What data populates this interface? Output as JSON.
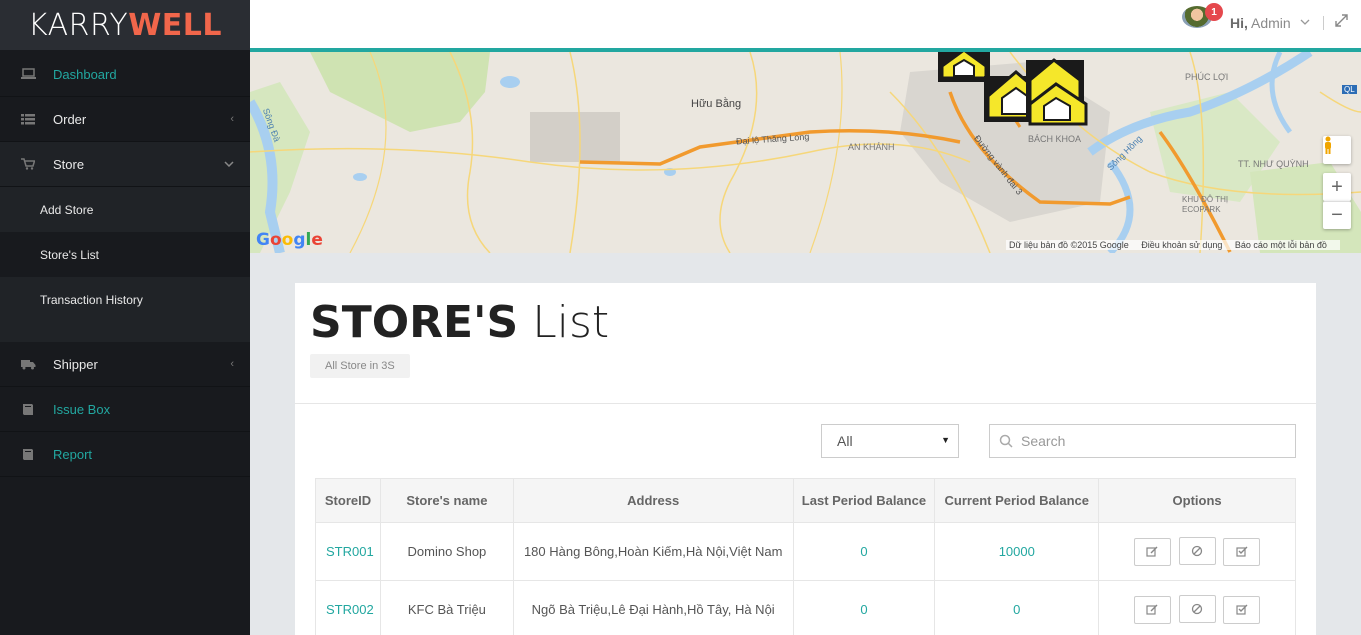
{
  "brand": {
    "part1": "KARRY",
    "part2": "WELL"
  },
  "sidebar": {
    "items": [
      {
        "label": "Dashboard",
        "icon": "laptop-icon"
      },
      {
        "label": "Order",
        "icon": "list-icon"
      },
      {
        "label": "Store",
        "icon": "cart-icon"
      },
      {
        "label": "Shipper",
        "icon": "truck-icon"
      },
      {
        "label": "Issue Box",
        "icon": "book-icon"
      },
      {
        "label": "Report",
        "icon": "book-icon"
      }
    ],
    "store_sub": [
      {
        "label": "Add Store"
      },
      {
        "label": "Store's List"
      },
      {
        "label": "Transaction History"
      }
    ]
  },
  "topbar": {
    "notification_count": "1",
    "greeting_hi": "Hi,",
    "greeting_name": "Admin"
  },
  "map": {
    "labels": {
      "huu_bang": "Hữu Bằng",
      "thang_long": "Đại lộ Thăng Long",
      "an_khanh": "AN KHÁNH",
      "bach_khoa": "BÁCH KHOA",
      "vanh_dai": "Đường vành đai 3",
      "song_hong": "Sông Hồng",
      "song_da": "Sông Đà",
      "phuc_loi": "PHÚC LỢI",
      "nhu_quynh": "TT. NHƯ QUỲNH",
      "ecopark": "KHU ĐÔ THỊ ECOPARK",
      "ql": "QL"
    },
    "google": "Google",
    "footer": {
      "data": "Dữ liệu bản đồ ©2015 Google",
      "terms": "Điều khoản sử dụng",
      "report": "Báo cáo một lỗi bản đồ"
    }
  },
  "page": {
    "title_bold": "STORE'S",
    "title_light": "List",
    "badge": "All Store in 3S"
  },
  "filters": {
    "select_value": "All",
    "search_placeholder": "Search"
  },
  "table": {
    "headers": [
      "StoreID",
      "Store's name",
      "Address",
      "Last Period Balance",
      "Current Period Balance",
      "Options"
    ],
    "rows": [
      {
        "id": "STR001",
        "name": "Domino Shop",
        "address": "180 Hàng Bông,Hoàn Kiếm,Hà Nội,Việt Nam",
        "last": "0",
        "current": "10000"
      },
      {
        "id": "STR002",
        "name": "KFC Bà Triệu",
        "address": "Ngõ Bà Triệu,Lê Đại Hành,Hồ Tây, Hà Nội",
        "last": "0",
        "current": "0"
      }
    ]
  },
  "colors": {
    "accent": "#22a7a0",
    "brand_orange": "#f1664b",
    "sidebar_bg": "#181a1e",
    "badge_red": "#e5484d"
  }
}
